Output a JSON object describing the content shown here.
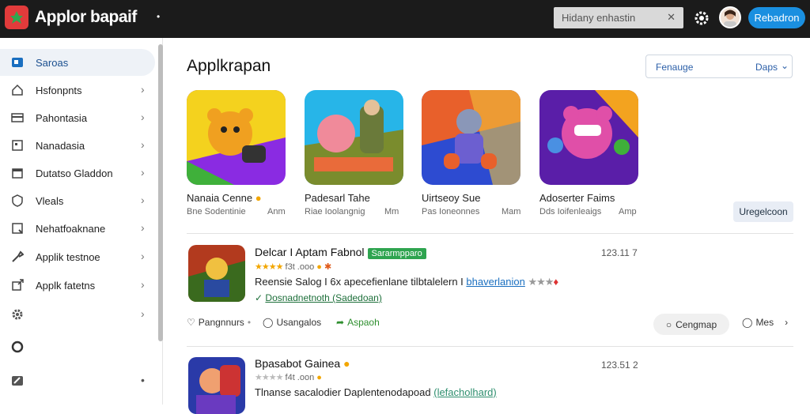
{
  "header": {
    "app_title": "Applor bapaif",
    "search_placeholder": "Hidany enhastin",
    "search_clear": "✕",
    "dot": "•",
    "action_button": "Rebadron"
  },
  "sidebar": {
    "items": [
      {
        "label": "Saroas",
        "icon": "store-icon",
        "chevron": ""
      },
      {
        "label": "Hsfonpnts",
        "icon": "home-icon",
        "chevron": "›"
      },
      {
        "label": "Pahontasia",
        "icon": "card-icon",
        "chevron": "›"
      },
      {
        "label": "Nanadasia",
        "icon": "grid-icon",
        "chevron": "›"
      },
      {
        "label": "Dutatso Gladdon",
        "icon": "calendar-icon",
        "chevron": "›"
      },
      {
        "label": "Vleals",
        "icon": "shield-icon",
        "chevron": "›"
      },
      {
        "label": "Nehatfoaknane",
        "icon": "document-icon",
        "chevron": "›"
      },
      {
        "label": "Applik testnoe",
        "icon": "wrench-icon",
        "chevron": "›"
      },
      {
        "label": "Applk fatetns",
        "icon": "share-icon",
        "chevron": "›"
      },
      {
        "label": "",
        "icon": "gear-icon",
        "chevron": "›"
      },
      {
        "label": "",
        "icon": "circle-icon",
        "chevron": ""
      },
      {
        "label": "",
        "icon": "edit-icon",
        "chevron": "•"
      }
    ]
  },
  "main": {
    "title": "Applkrapan",
    "sort": {
      "label": "Fenauge",
      "value": "Daps",
      "chevron": "⌄"
    },
    "featured": [
      {
        "name": "Nanaia Cenne",
        "sub": "Bne Sodentinie",
        "meta": "Anm",
        "has_badge": true,
        "palette": [
          "#f4d21e",
          "#3fb03a",
          "#8a2be2"
        ]
      },
      {
        "name": "Padesarl Tahe",
        "sub": "Riae Ioolangnig",
        "meta": "Mm",
        "has_badge": false,
        "palette": [
          "#27b5e8",
          "#e96b3a",
          "#7a8c2d"
        ]
      },
      {
        "name": "Uirtseoy Sue",
        "sub": "Pas Ioneonnes",
        "meta": "Mam",
        "has_badge": false,
        "palette": [
          "#e8602b",
          "#2d4bd1",
          "#f0c33a"
        ]
      },
      {
        "name": "Adoserter Faims",
        "sub": "Dds Ioifenleaigs",
        "meta": "Amp",
        "has_badge": false,
        "palette": [
          "#e04fa8",
          "#5a1ea8",
          "#f3a31f"
        ]
      }
    ],
    "update_button": "Uregelcoon",
    "rows": [
      {
        "title": "Delcar I Aptam Fabnol",
        "badge": "Sararmpparo",
        "time": "123.11 7",
        "stars": "★★★★",
        "rating": "f3t .ooo",
        "desc": "Reensie Salog I 6x apecefienlane tilbtalelern I",
        "desc_link": "bhaverlanion",
        "desc_tail": "★★★",
        "note_prefix": "✓",
        "note": "Dosnadnetnoth (Sadedoan)"
      },
      {
        "title": "Bpasabot Gainea",
        "badge": "",
        "time": "123.51 2",
        "stars": "★★★★",
        "rating": "f4t .oon",
        "desc": "Tlnanse sacalodier Daplentenodapoad",
        "desc_link": "(lefacholhard)",
        "desc_tail": "",
        "note_prefix": "",
        "note": ""
      }
    ],
    "actions": {
      "like": "Pangnnurs",
      "comment": "Usangalos",
      "share": "Aspaoh",
      "compare": "Cengmap",
      "more": "Mes"
    }
  }
}
